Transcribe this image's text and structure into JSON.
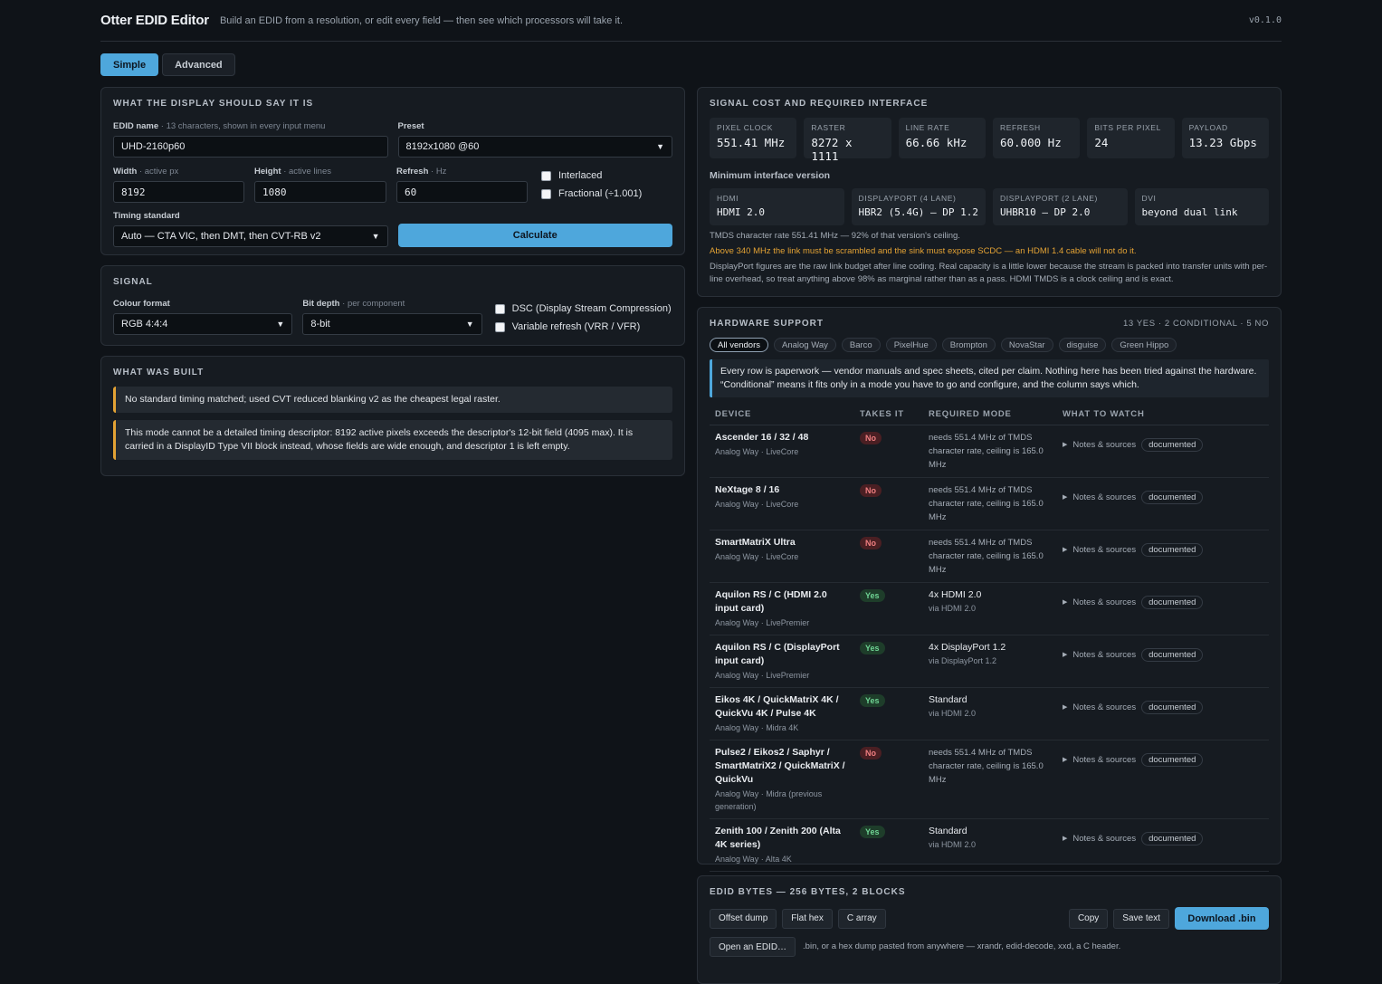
{
  "header": {
    "title": "Otter EDID Editor",
    "tagline": "Build an EDID from a resolution, or edit every field — then see which processors will take it.",
    "version": "v0.1.0"
  },
  "modes": {
    "simple": "Simple",
    "advanced": "Advanced",
    "active": "Simple"
  },
  "display_panel": {
    "title": "What the display should say it is",
    "edid_name_label": "EDID name",
    "edid_name_hint": "· 13 characters, shown in every input menu",
    "edid_name_value": "UHD-2160p60",
    "preset_label": "Preset",
    "preset_value": "8192x1080 @60",
    "width_label": "Width",
    "width_hint": "· active px",
    "width_value": "8192",
    "height_label": "Height",
    "height_hint": "· active lines",
    "height_value": "1080",
    "refresh_label": "Refresh",
    "refresh_hint": "· Hz",
    "refresh_value": "60",
    "interlaced_label": "Interlaced",
    "fractional_label": "Fractional (÷1.001)",
    "timing_label": "Timing standard",
    "timing_value": "Auto — CTA VIC, then DMT, then CVT-RB v2",
    "calculate_label": "Calculate"
  },
  "signal_panel": {
    "title": "Signal",
    "colour_label": "Colour format",
    "colour_value": "RGB 4:4:4",
    "bitdepth_label": "Bit depth",
    "bitdepth_hint": "· per component",
    "bitdepth_value": "8-bit",
    "dsc_label": "DSC (Display Stream Compression)",
    "vrr_label": "Variable refresh (VRR / VFR)"
  },
  "built_panel": {
    "title": "What was built",
    "note1": "No standard timing matched; used CVT reduced blanking v2 as the cheapest legal raster.",
    "note2": "This mode cannot be a detailed timing descriptor: 8192 active pixels exceeds the descriptor's 12-bit field (4095 max). It is carried in a DisplayID Type VII block instead, whose fields are wide enough, and descriptor 1 is left empty."
  },
  "signal_cost": {
    "title": "Signal cost and required interface",
    "metrics": [
      {
        "label": "Pixel clock",
        "value": "551.41 MHz"
      },
      {
        "label": "Raster",
        "value": "8272 x 1111"
      },
      {
        "label": "Line rate",
        "value": "66.66 kHz"
      },
      {
        "label": "Refresh",
        "value": "60.000 Hz"
      },
      {
        "label": "Bits per pixel",
        "value": "24"
      },
      {
        "label": "Payload",
        "value": "13.23 Gbps"
      }
    ],
    "min_interface_title": "Minimum interface version",
    "interfaces": [
      {
        "label": "HDMI",
        "value": "HDMI 2.0"
      },
      {
        "label": "DisplayPort (4 lane)",
        "value": "HBR2 (5.4G) — DP 1.2"
      },
      {
        "label": "DisplayPort (2 lane)",
        "value": "UHBR10 — DP 2.0"
      },
      {
        "label": "DVI",
        "value": "beyond dual link"
      }
    ],
    "tmds_note": "TMDS character rate 551.41 MHz — 92% of that version's ceiling.",
    "warning": "Above 340 MHz the link must be scrambled and the sink must expose SCDC — an HDMI 1.4 cable will not do it.",
    "dp_note": "DisplayPort figures are the raw link budget after line coding. Real capacity is a little lower because the stream is packed into transfer units with per-line overhead, so treat anything above 98% as marginal rather than as a pass. HDMI TMDS is a clock ceiling and is exact."
  },
  "hardware": {
    "title": "Hardware support",
    "counts": "13 YES · 2 CONDITIONAL · 5 NO",
    "vendors": [
      "All vendors",
      "Analog Way",
      "Barco",
      "PixelHue",
      "Brompton",
      "NovaStar",
      "disguise",
      "Green Hippo"
    ],
    "callout": "Every row is paperwork — vendor manuals and spec sheets, cited per claim. Nothing here has been tried against the hardware. “Conditional” means it fits only in a mode you have to go and configure, and the column says which.",
    "columns": [
      "Device",
      "Takes it",
      "Required mode",
      "What to watch"
    ],
    "notes_label": "Notes & sources",
    "tag_label": "documented",
    "rows": [
      {
        "name": "Ascender 16 / 32 / 48",
        "vendor": "Analog Way · LiveCore",
        "takes": "No",
        "req_main": "",
        "req": "needs 551.4 MHz of TMDS character rate, ceiling is 165.0 MHz"
      },
      {
        "name": "NeXtage 8 / 16",
        "vendor": "Analog Way · LiveCore",
        "takes": "No",
        "req_main": "",
        "req": "needs 551.4 MHz of TMDS character rate, ceiling is 165.0 MHz"
      },
      {
        "name": "SmartMatriX Ultra",
        "vendor": "Analog Way · LiveCore",
        "takes": "No",
        "req_main": "",
        "req": "needs 551.4 MHz of TMDS character rate, ceiling is 165.0 MHz"
      },
      {
        "name": "Aquilon RS / C (HDMI 2.0 input card)",
        "vendor": "Analog Way · LivePremier",
        "takes": "Yes",
        "req_main": "4x HDMI 2.0",
        "req": "via HDMI 2.0"
      },
      {
        "name": "Aquilon RS / C (DisplayPort input card)",
        "vendor": "Analog Way · LivePremier",
        "takes": "Yes",
        "req_main": "4x DisplayPort 1.2",
        "req": "via DisplayPort 1.2"
      },
      {
        "name": "Eikos 4K / QuickMatriX 4K / QuickVu 4K / Pulse 4K",
        "vendor": "Analog Way · Midra 4K",
        "takes": "Yes",
        "req_main": "Standard",
        "req": "via HDMI 2.0"
      },
      {
        "name": "Pulse2 / Eikos2 / Saphyr / SmartMatriX2 / QuickMatriX / QuickVu",
        "vendor": "Analog Way · Midra (previous generation)",
        "takes": "No",
        "req_main": "",
        "req": "needs 551.4 MHz of TMDS character rate, ceiling is 165.0 MHz"
      },
      {
        "name": "Zenith 100 / Zenith 200 (Alta 4K series)",
        "vendor": "Analog Way · Alta 4K",
        "takes": "Yes",
        "req_main": "Standard",
        "req": "via HDMI 2.0"
      }
    ]
  },
  "bytes_panel": {
    "title": "EDID bytes — 256 bytes, 2 blocks",
    "formats": [
      "Offset dump",
      "Flat hex",
      "C array"
    ],
    "copy": "Copy",
    "save_text": "Save text",
    "download": "Download .bin",
    "open": "Open an EDID…",
    "open_hint": ".bin, or a hex dump pasted from anywhere — xrandr, edid-decode, xxd, a C header."
  }
}
